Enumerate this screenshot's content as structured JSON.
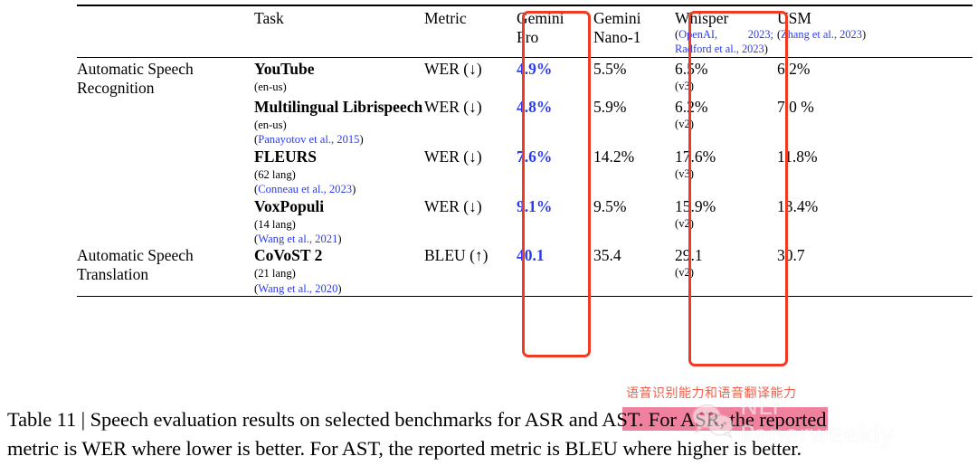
{
  "table": {
    "columns": [
      {
        "key": "task",
        "label": ""
      },
      {
        "key": "bench",
        "label": "Task"
      },
      {
        "key": "metric",
        "label": "Metric"
      },
      {
        "key": "gemini_pro",
        "label": "Gemini Pro"
      },
      {
        "key": "gemini_nano_1",
        "label": "Gemini Nano-1"
      },
      {
        "key": "whisper",
        "label": "Whisper"
      },
      {
        "key": "usm",
        "label": "USM"
      }
    ],
    "header": {
      "task_label": "Task",
      "metric_label": "Metric",
      "gemini_pro_line1": "Gemini",
      "gemini_pro_line2": "Pro",
      "gemini_nano_line1": "Gemini",
      "gemini_nano_line2": "Nano-1",
      "whisper_label": "Whisper",
      "whisper_cite": "(OpenAI, 2023; Radford et al., 2023)",
      "usm_label": "USM",
      "usm_cite": "(Zhang et al., 2023)"
    },
    "rows": [
      {
        "task": "Automatic Speech Recognition",
        "bench_name": "YouTube",
        "bench_sub": "(en-us)",
        "bench_cite": "",
        "metric": "WER (↓)",
        "gemini_pro": "4.9%",
        "gemini_nano_1": "5.5%",
        "whisper": "6.5%",
        "whisper_version": "(v3)",
        "usm": "6.2%"
      },
      {
        "task": "",
        "bench_name": "Multilingual Librispeech",
        "bench_sub": "(en-us)",
        "bench_cite": "(Panayotov et al., 2015)",
        "metric": "WER (↓)",
        "gemini_pro": "4.8%",
        "gemini_nano_1": "5.9%",
        "whisper": "6.2%",
        "whisper_version": "(v2)",
        "usm": "7.0 %"
      },
      {
        "task": "",
        "bench_name": "FLEURS",
        "bench_sub": "(62 lang)",
        "bench_cite": "(Conneau et al., 2023)",
        "metric": "WER (↓)",
        "gemini_pro": "7.6%",
        "gemini_nano_1": "14.2%",
        "whisper": "17.6%",
        "whisper_version": "(v3)",
        "usm": "11.8%"
      },
      {
        "task": "",
        "bench_name": "VoxPopuli",
        "bench_sub": "(14 lang)",
        "bench_cite": "(Wang et al., 2021)",
        "metric": "WER (↓)",
        "gemini_pro": "9.1%",
        "gemini_nano_1": "9.5%",
        "whisper": "15.9%",
        "whisper_version": "(v2)",
        "usm": "13.4%"
      },
      {
        "task": "Automatic Speech Translation",
        "bench_name": "CoVoST 2",
        "bench_sub": "(21 lang)",
        "bench_cite": "(Wang et al., 2020)",
        "metric": "BLEU (↑)",
        "gemini_pro": "40.1",
        "gemini_nano_1": "35.4",
        "whisper": "29.1",
        "whisper_version": "(v2)",
        "usm": "30.7"
      }
    ]
  },
  "caption": {
    "line1": "Table 11 | Speech evaluation results on selected benchmarks for ASR and AST. For ASR, the reported",
    "line2": "metric is WER where lower is better. For AST, the reported metric is BLEU where higher is better."
  },
  "annotations": {
    "chinese_note": "语音识别能力和语音翻译能力",
    "highlight_color": "#ea5e84",
    "box_color": "#ef3b23",
    "accent_color": "#2b3cf0",
    "watermark_text": "NLP Paperweekly"
  }
}
